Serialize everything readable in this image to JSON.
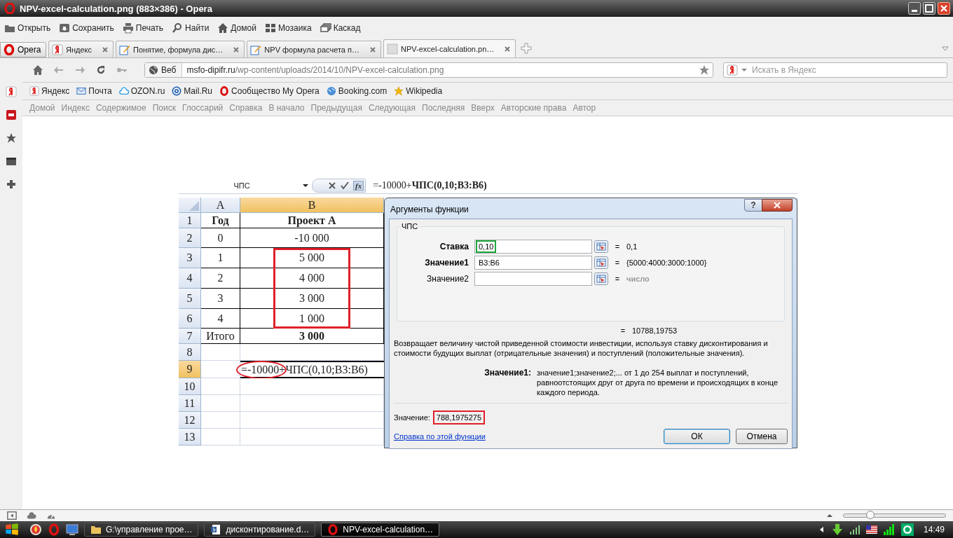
{
  "window": {
    "title": "NPV-excel-calculation.png (883×386) - Opera"
  },
  "toolbar": [
    {
      "label": "Открыть",
      "kind": "folder"
    },
    {
      "label": "Сохранить",
      "kind": "save"
    },
    {
      "label": "Печать",
      "kind": "print"
    },
    {
      "label": "Найти",
      "kind": "search"
    },
    {
      "label": "Домой",
      "kind": "home"
    },
    {
      "label": "Мозаика",
      "kind": "tile"
    },
    {
      "label": "Каскад",
      "kind": "cascade"
    }
  ],
  "menu_button": "Opera",
  "tabs": [
    {
      "title": "Яндекс",
      "kind": "yandex",
      "selected": false
    },
    {
      "title": "Понятие, формула дис…",
      "kind": "doc",
      "selected": false
    },
    {
      "title": "NPV формула расчета п…",
      "kind": "doc",
      "selected": false
    },
    {
      "title": "NPV-excel-calculation.pn…",
      "kind": "image",
      "selected": true
    }
  ],
  "address": {
    "scope": "Веб",
    "host": "msfo-dipifr.ru",
    "path": "/wp-content/uploads/2014/10/NPV-excel-calculation.png"
  },
  "search": {
    "placeholder": "Искать в Яндекс"
  },
  "bookmarks": [
    {
      "label": "Яндекс",
      "kind": "yandex"
    },
    {
      "label": "Почта",
      "kind": "mail"
    },
    {
      "label": "OZON.ru",
      "kind": "cloud"
    },
    {
      "label": "Mail.Ru",
      "kind": "at"
    },
    {
      "label": "Сообщество My Opera",
      "kind": "opera"
    },
    {
      "label": "Booking.com",
      "kind": "globe"
    },
    {
      "label": "Wikipedia",
      "kind": "star"
    }
  ],
  "nav_links": [
    "Домой",
    "Индекс",
    "Содержимое",
    "Поиск",
    "Глоссарий",
    "Справка",
    "В начало",
    "Предыдущая",
    "Следующая",
    "Последняя",
    "Вверх",
    "Авторские права",
    "Автор"
  ],
  "sheet": {
    "name_box": "ЧПС",
    "fx": "fx",
    "formula": "=-10000+**ЧПС(0,10;B3:B6)**",
    "columns": [
      {
        "label": "A",
        "active": false
      },
      {
        "label": "B",
        "active": true
      }
    ],
    "rows": [
      {
        "num": "1",
        "active": false,
        "kind": "table",
        "framed": false,
        "a": {
          "text": "Год",
          "bold": true
        },
        "b": {
          "text": "Проект А",
          "bold": true
        }
      },
      {
        "num": "2",
        "active": false,
        "kind": "table",
        "framed": false,
        "a": {
          "text": "0",
          "bold": false
        },
        "b": {
          "text": "-10 000",
          "bold": false
        }
      },
      {
        "num": "3",
        "active": false,
        "kind": "table",
        "framed": true,
        "a": {
          "text": "1",
          "bold": false
        },
        "b": {
          "text": "5 000",
          "bold": false
        }
      },
      {
        "num": "4",
        "active": false,
        "kind": "table",
        "framed": true,
        "a": {
          "text": "2",
          "bold": false
        },
        "b": {
          "text": "4 000",
          "bold": false
        }
      },
      {
        "num": "5",
        "active": false,
        "kind": "table",
        "framed": true,
        "a": {
          "text": "3",
          "bold": false
        },
        "b": {
          "text": "3 000",
          "bold": false
        }
      },
      {
        "num": "6",
        "active": false,
        "kind": "table",
        "framed": true,
        "a": {
          "text": "4",
          "bold": false
        },
        "b": {
          "text": "1 000",
          "bold": false
        }
      },
      {
        "num": "7",
        "active": false,
        "kind": "table",
        "framed": false,
        "a": {
          "text": "Итого",
          "bold": false
        },
        "b": {
          "text": "3 000",
          "bold": true
        }
      },
      {
        "num": "8",
        "active": false,
        "kind": "empty",
        "framed": false
      },
      {
        "num": "9",
        "active": true,
        "kind": "formula",
        "framed": false,
        "b": {
          "text": "=-10000+ЧПС(0,10;B3:B6)",
          "bold": false,
          "circled": true
        }
      },
      {
        "num": "10",
        "active": false,
        "kind": "empty",
        "framed": false
      },
      {
        "num": "11",
        "active": false,
        "kind": "empty",
        "framed": false
      },
      {
        "num": "12",
        "active": false,
        "kind": "empty",
        "framed": false
      },
      {
        "num": "13",
        "active": false,
        "kind": "empty",
        "framed": false
      }
    ]
  },
  "dialog": {
    "title": "Аргументы функции",
    "help_glyph": "?",
    "group": "ЧПС",
    "args": [
      {
        "label": "Ставка",
        "required": true,
        "value": "0,10",
        "focused": true,
        "equals": "=",
        "result": "0,1",
        "muted": false
      },
      {
        "label": "Значение1",
        "required": true,
        "value": "B3:B6",
        "focused": false,
        "equals": "=",
        "result": "{5000:4000:3000:1000}",
        "muted": false
      },
      {
        "label": "Значение2",
        "required": false,
        "focused": false,
        "equals": "=",
        "result": "число",
        "muted": true
      }
    ],
    "total": {
      "equals": "=",
      "value": "10788,19753"
    },
    "description": "Возвращает величину чистой приведенной стоимости инвестиции, используя ставку дисконтирования и стоимости будущих выплат (отрицательные значения) и поступлений (положительные значения).",
    "arg_help": {
      "label": "Значение1:",
      "text": "значение1;значение2;... от 1 до 254 выплат и поступлений, равноотстоящих друг от друга по времени и происходящих в конце каждого периода."
    },
    "result": {
      "label": "Значение:",
      "value": "788,1975275",
      "highlighted": true
    },
    "help_link": "Справка по этой функции",
    "buttons": [
      {
        "label": "ОК",
        "default": true
      },
      {
        "label": "Отмена",
        "default": false
      }
    ]
  },
  "status_bar": {
    "zoom": {
      "level": 0.26
    }
  },
  "taskbar": {
    "tasks": [
      {
        "label": "G:\\управление прое…",
        "kind": "folder",
        "selected": false
      },
      {
        "label": "дисконтирование.d…",
        "kind": "word",
        "selected": false
      },
      {
        "label": "NPV-excel-calculation…",
        "kind": "opera",
        "selected": true
      }
    ],
    "clock": "14:49"
  }
}
